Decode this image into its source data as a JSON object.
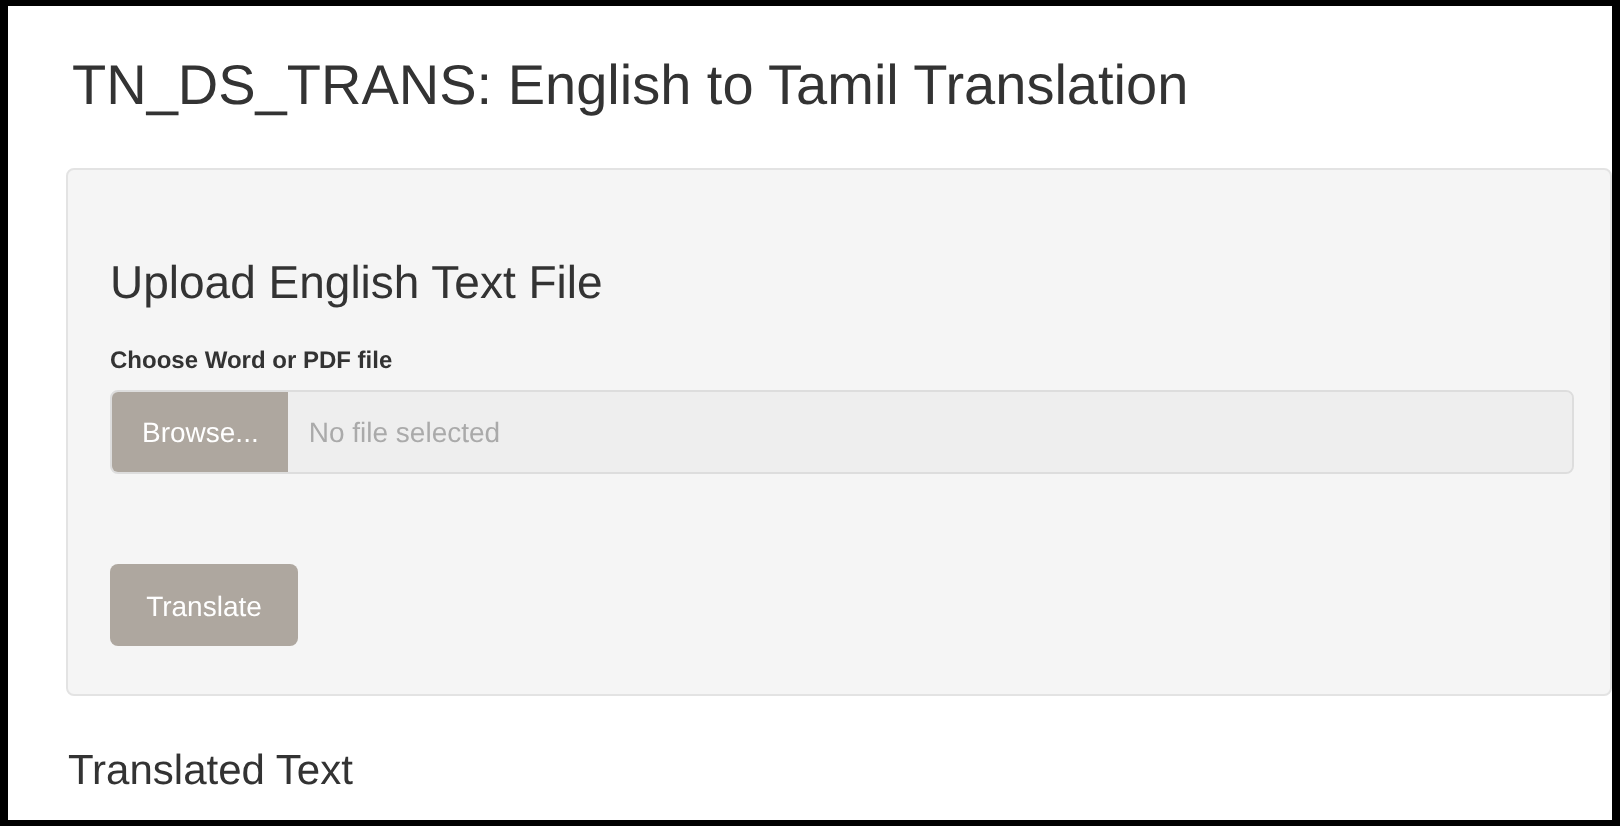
{
  "title": "TN_DS_TRANS: English to Tamil Translation",
  "panel": {
    "heading": "Upload English Text File",
    "file_input": {
      "label": "Choose Word or PDF file",
      "button": "Browse...",
      "placeholder": "No file selected"
    },
    "button": "Translate"
  },
  "section_heading": "Translated Text"
}
